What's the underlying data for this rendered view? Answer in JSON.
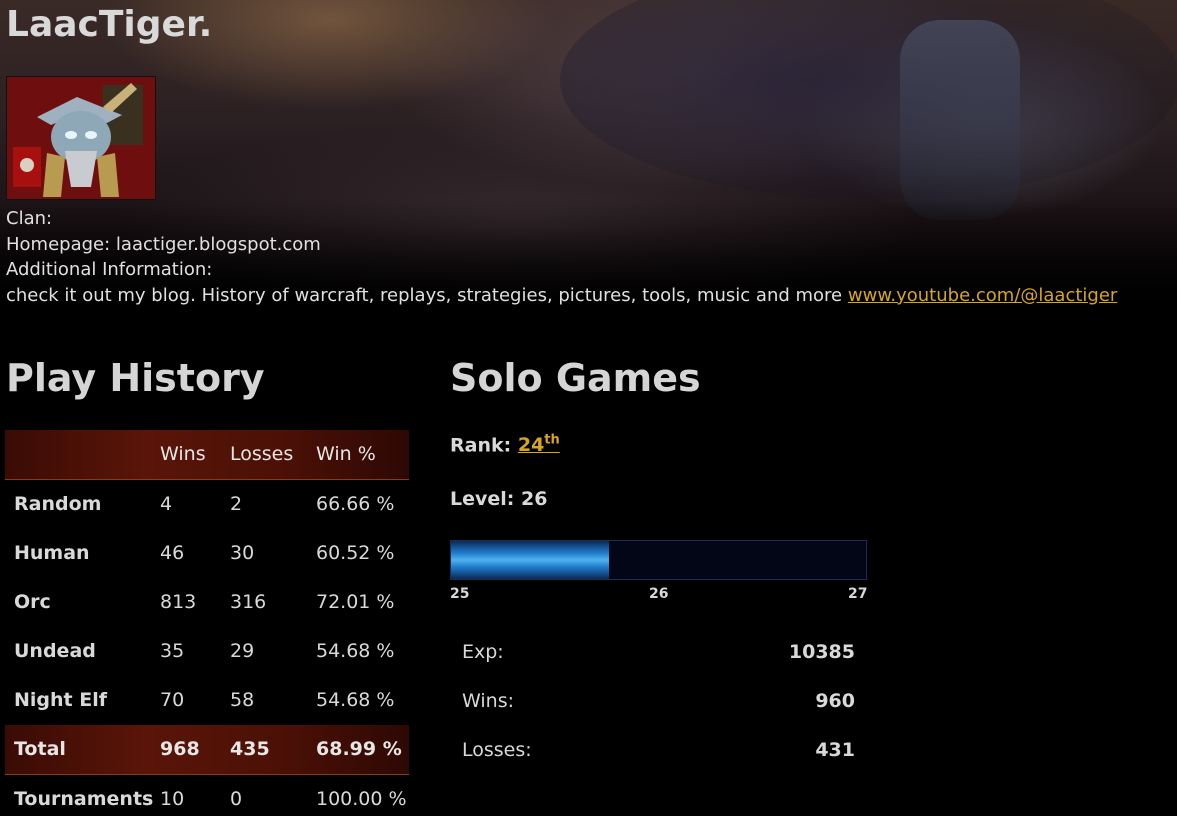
{
  "profile": {
    "username": "LaacTiger.",
    "clan_label": "Clan:",
    "homepage_label": "Homepage:",
    "homepage_value": "laactiger.blogspot.com",
    "additional_label": "Additional Information:",
    "additional_text": "check it out my blog. History of warcraft, replays, strategies, pictures, tools, music and more",
    "youtube_link": "www.youtube.com/@laactiger"
  },
  "play_history": {
    "title": "Play History",
    "headers": {
      "wins": "Wins",
      "losses": "Losses",
      "pct": "Win %"
    },
    "rows": [
      {
        "label": "Random",
        "wins": "4",
        "losses": "2",
        "pct": "66.66 %"
      },
      {
        "label": "Human",
        "wins": "46",
        "losses": "30",
        "pct": "60.52 %"
      },
      {
        "label": "Orc",
        "wins": "813",
        "losses": "316",
        "pct": "72.01 %"
      },
      {
        "label": "Undead",
        "wins": "35",
        "losses": "29",
        "pct": "54.68 %"
      },
      {
        "label": "Night Elf",
        "wins": "70",
        "losses": "58",
        "pct": "54.68 %"
      }
    ],
    "total": {
      "label": "Total",
      "wins": "968",
      "losses": "435",
      "pct": "68.99 %"
    },
    "tournaments": {
      "label": "Tournaments",
      "wins": "10",
      "losses": "0",
      "pct": "100.00 %"
    }
  },
  "solo_games": {
    "title": "Solo Games",
    "rank_label": "Rank:",
    "rank_value": "24",
    "rank_suffix": "th",
    "level_label": "Level:",
    "level_value": "26",
    "xp_progress_fraction": 0.38,
    "xp_ticks": [
      "25",
      "26",
      "27"
    ],
    "stats": [
      {
        "label": "Exp:",
        "value": "10385"
      },
      {
        "label": "Wins:",
        "value": "960"
      },
      {
        "label": "Losses:",
        "value": "431"
      }
    ]
  }
}
